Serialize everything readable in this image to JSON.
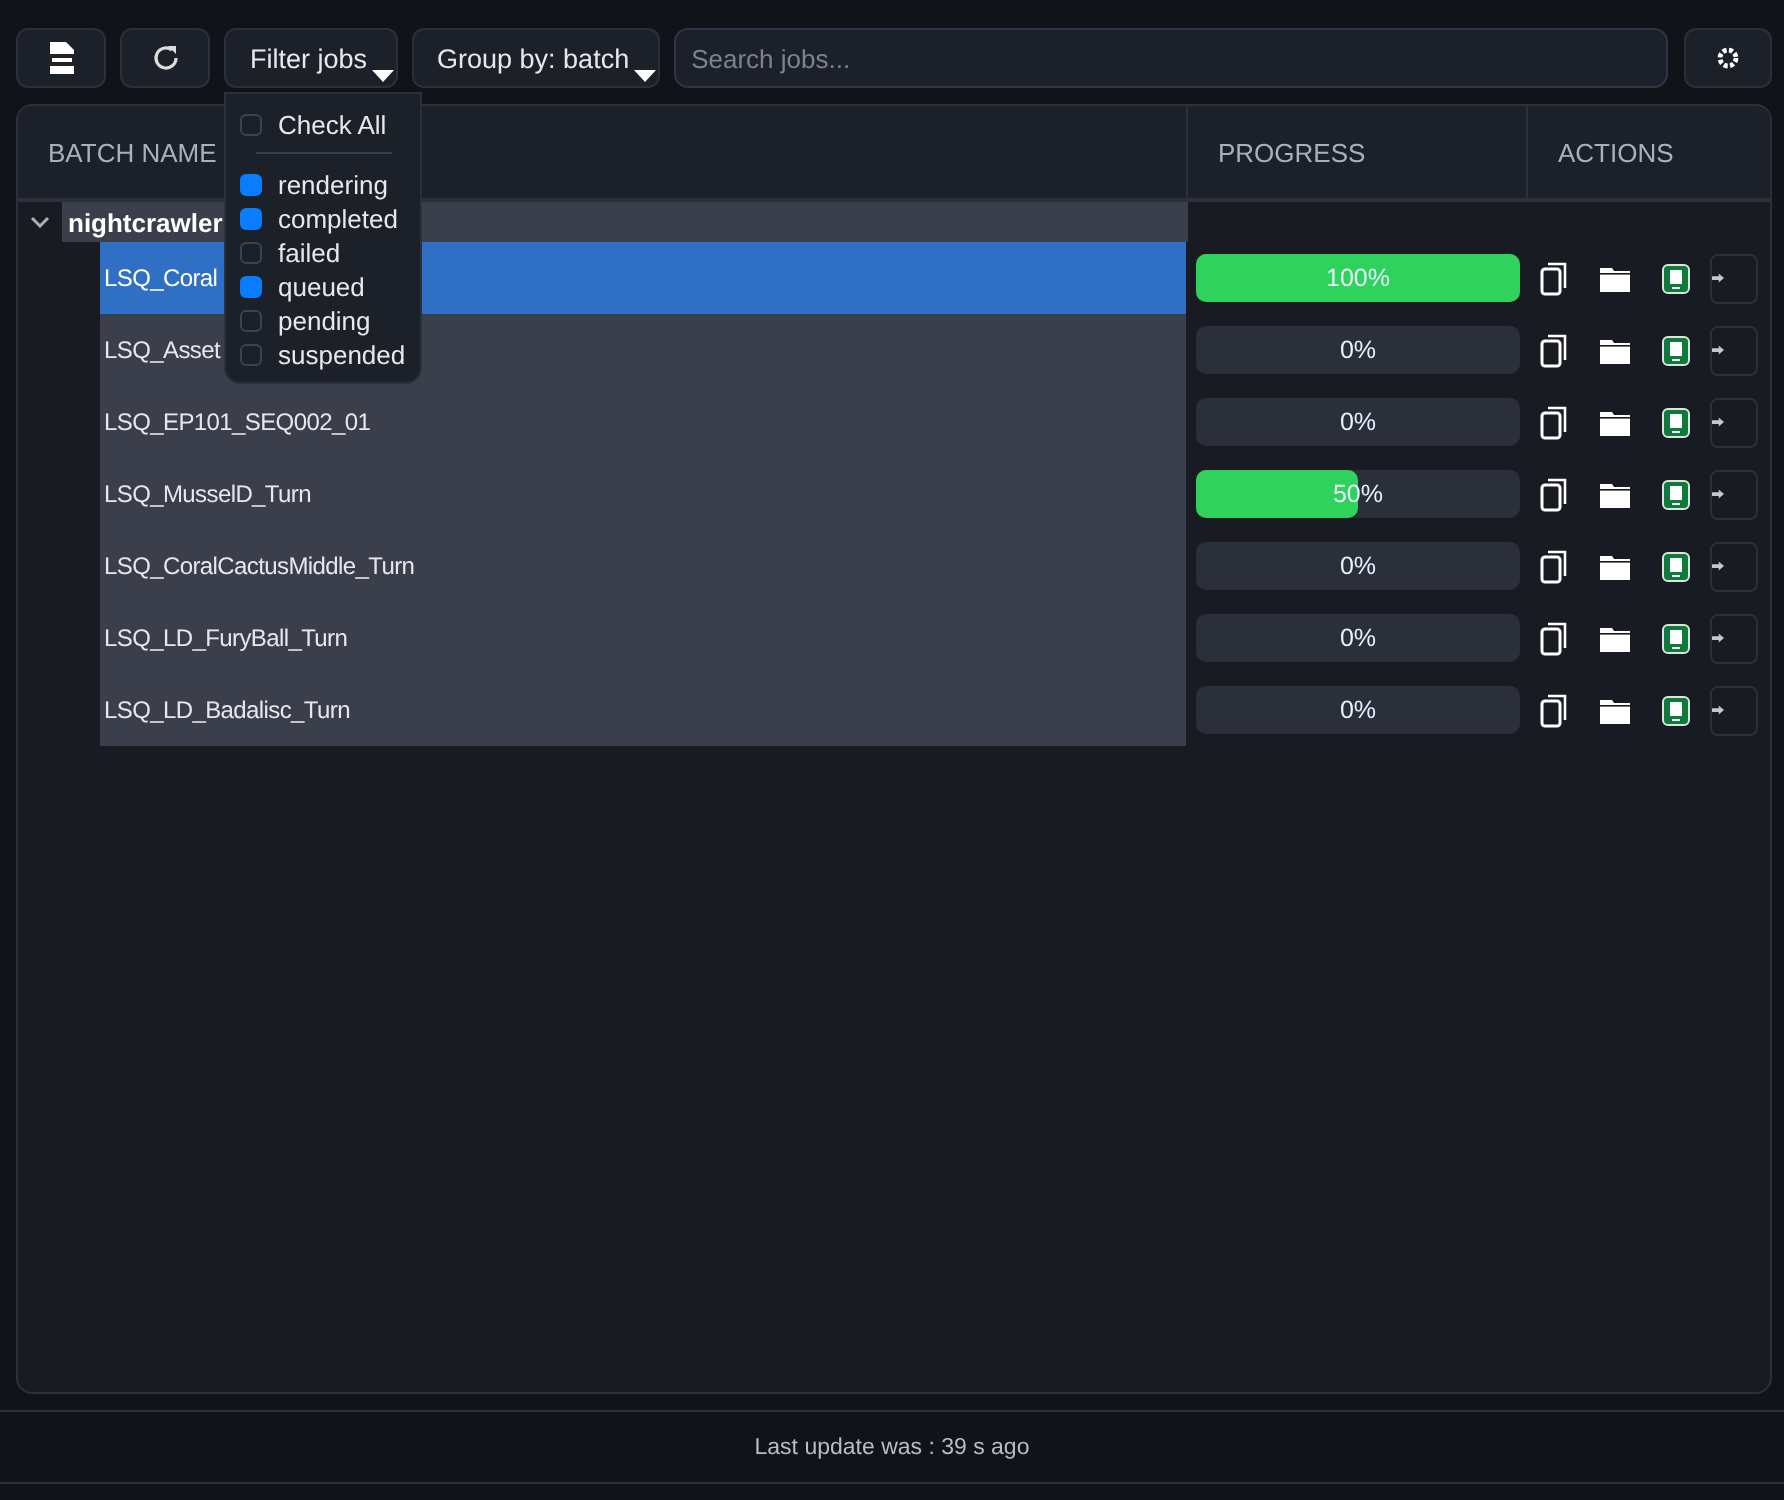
{
  "toolbar": {
    "filter_button": {
      "label": "Filter jobs",
      "open": true
    },
    "group_button": {
      "label": "Group by: batch"
    },
    "search": {
      "placeholder": "Search jobs..."
    }
  },
  "filter_menu": {
    "check_all": {
      "label": "Check All",
      "checked": false
    },
    "options": [
      {
        "label": "rendering",
        "checked": true
      },
      {
        "label": "completed",
        "checked": true
      },
      {
        "label": "failed",
        "checked": false
      },
      {
        "label": "queued",
        "checked": true
      },
      {
        "label": "pending",
        "checked": false
      },
      {
        "label": "suspended",
        "checked": false
      }
    ]
  },
  "table": {
    "columns": [
      "BATCH NAME",
      "PROGRESS",
      "ACTIONS"
    ],
    "groups": [
      {
        "name": "nightcrawler",
        "expanded": true,
        "jobs": [
          {
            "name": "LSQ_Coral",
            "selected": true,
            "level": 1,
            "reading": "100%"
          },
          {
            "name": "LSQ_Asset",
            "selected": false,
            "level": 0,
            "reading": "0%"
          },
          {
            "name": "LSQ_EP101_SEQ002_01",
            "selected": false,
            "level": 0,
            "reading": "0%"
          },
          {
            "name": "LSQ_MusselD_Turn",
            "selected": false,
            "level": 0.5,
            "reading": "50%"
          },
          {
            "name": "LSQ_CoralCactusMiddle_Turn",
            "selected": false,
            "level": 0,
            "reading": "0%"
          },
          {
            "name": "LSQ_LD_FuryBall_Turn",
            "selected": false,
            "level": 0,
            "reading": "0%"
          },
          {
            "name": "LSQ_LD_Badalisc_Turn",
            "selected": false,
            "level": 0,
            "reading": "0%"
          }
        ]
      }
    ]
  },
  "status_bar": {
    "text": "Last update was : 39 s ago"
  }
}
